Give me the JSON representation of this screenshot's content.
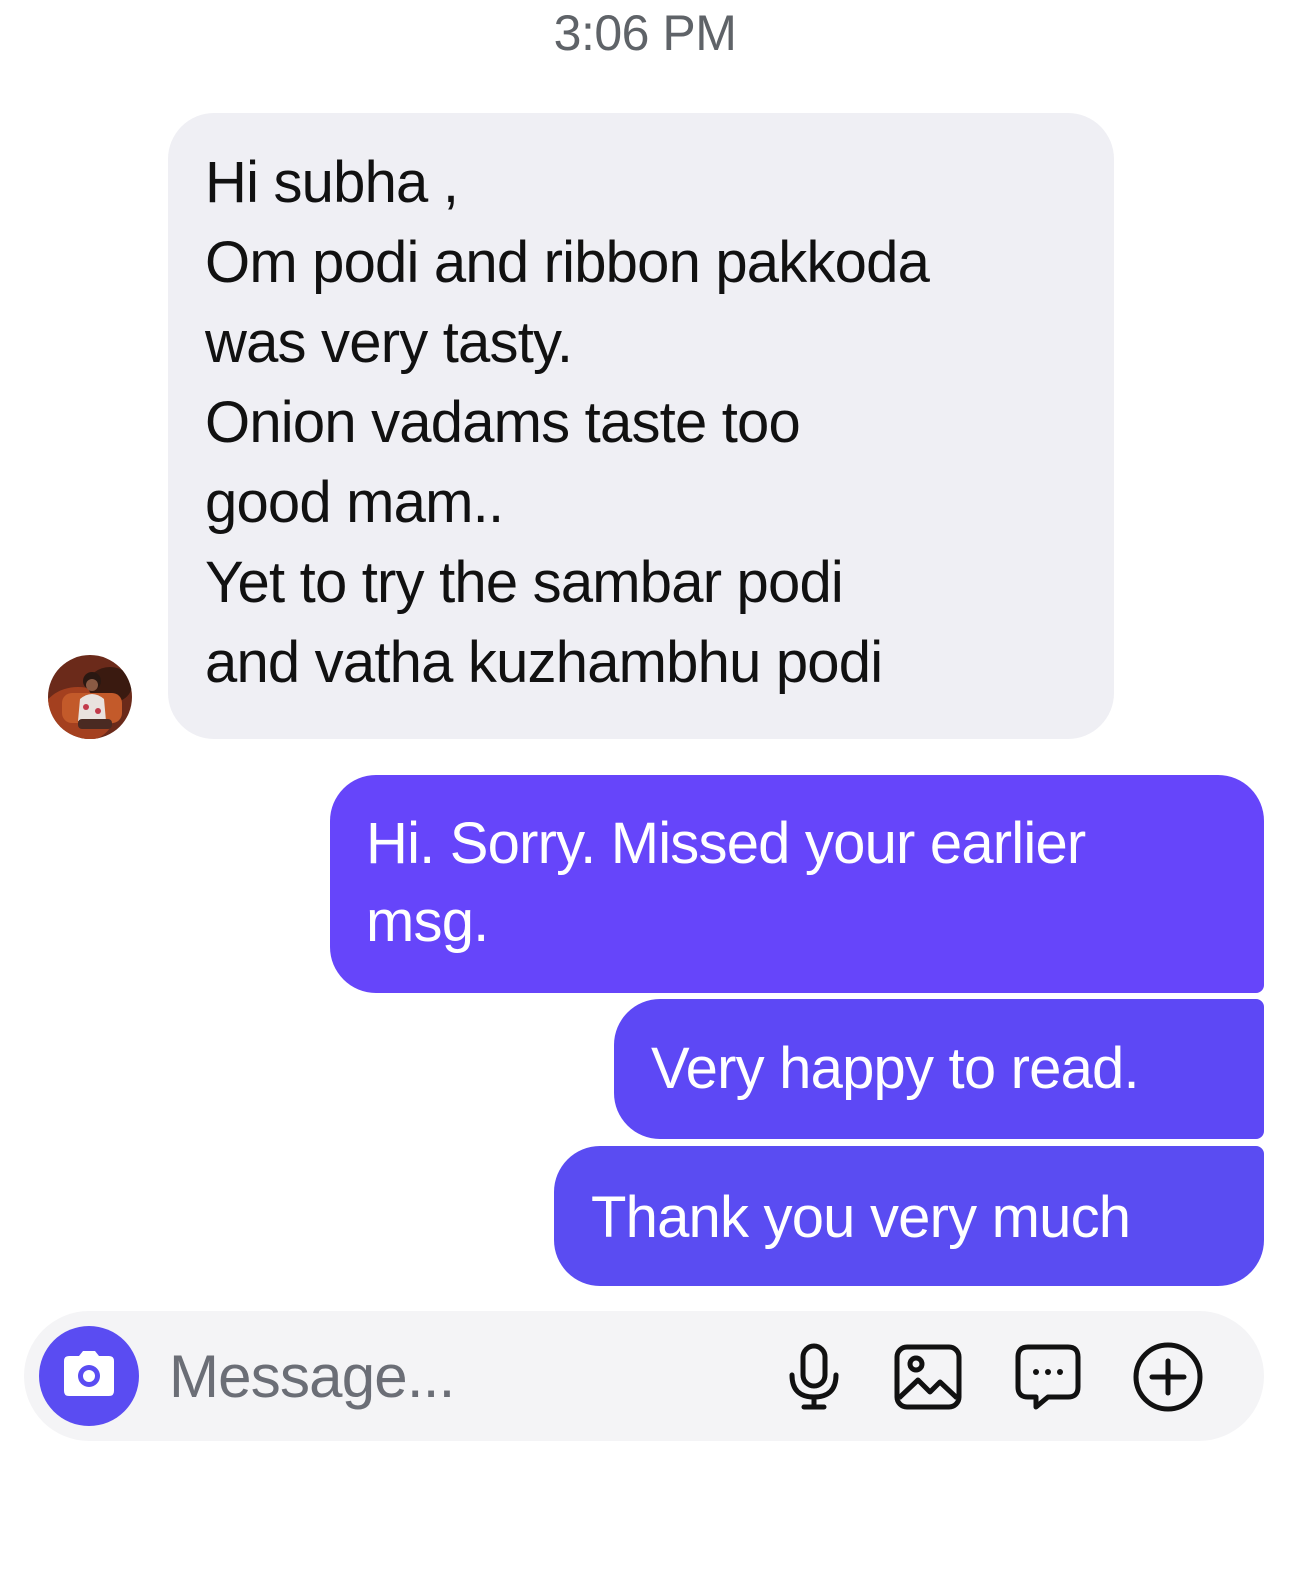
{
  "header": {
    "timestamp": "3:06 PM"
  },
  "conversation": {
    "received": {
      "sender_avatar": "avatar",
      "lines": [
        "Hi subha ,",
        "Om podi and ribbon pakkoda",
        "was very tasty.",
        "Onion vadams taste too",
        "good mam..",
        "Yet to try the sambar podi",
        "and vatha kuzhambhu podi"
      ]
    },
    "sent": [
      {
        "lines": [
          "Hi. Sorry. Missed your earlier",
          "msg."
        ]
      },
      {
        "text": "Very happy to read."
      },
      {
        "text": "Thank you very much"
      }
    ]
  },
  "composer": {
    "placeholder": "Message...",
    "icons": {
      "camera": "camera-icon",
      "microphone": "microphone-icon",
      "gallery": "image-icon",
      "sticker": "chat-bubble-icon",
      "more": "plus-circle-icon"
    }
  },
  "colors": {
    "sent_bubble": "#6444f8",
    "received_bubble": "#efeff4",
    "composer_background": "#f4f4f6",
    "timestamp_text": "#5f6368"
  }
}
